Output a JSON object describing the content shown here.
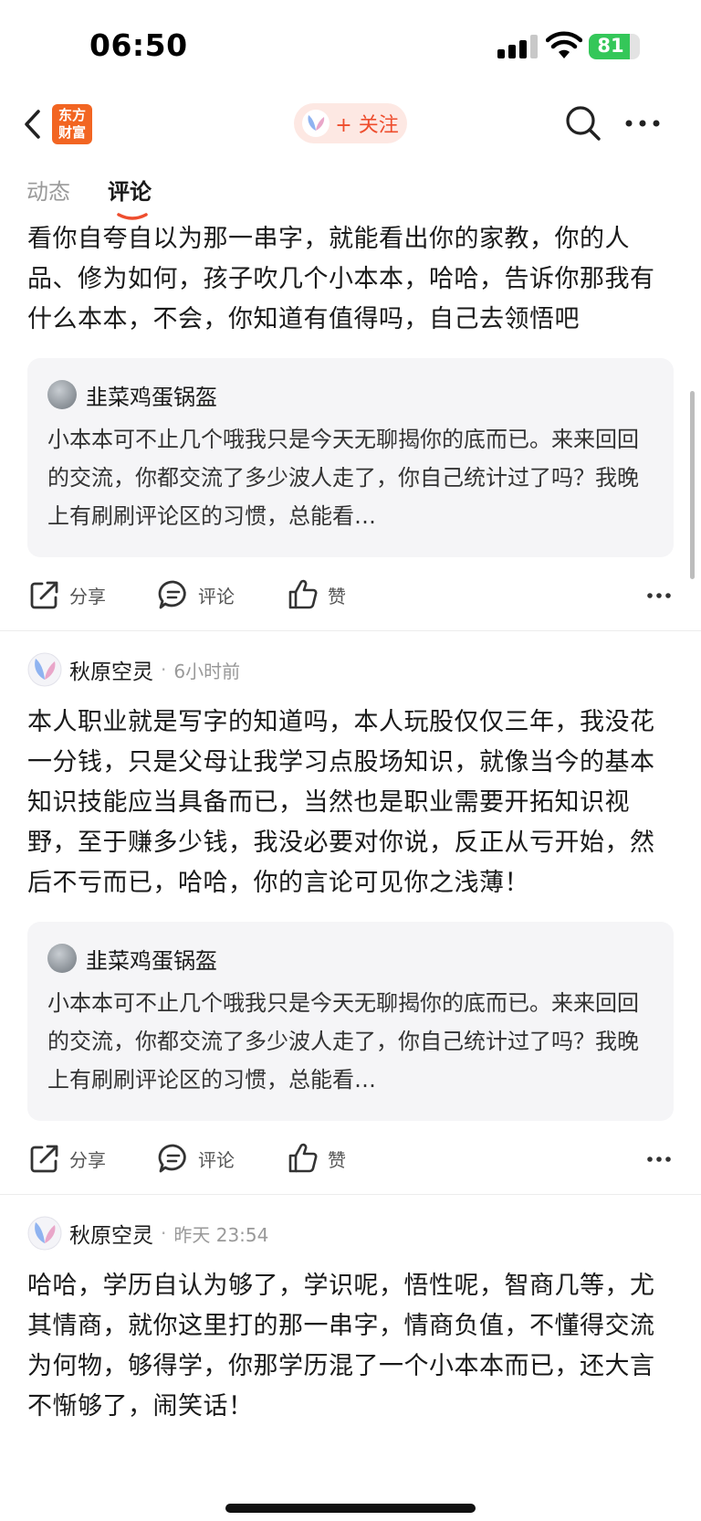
{
  "status_bar": {
    "time": "06:50",
    "battery": "81",
    "battery_level": 0.81
  },
  "nav": {
    "logo_line1": "东方",
    "logo_line2": "财富",
    "follow_label": "+ 关注"
  },
  "tabs": [
    {
      "label": "动态"
    },
    {
      "label": "评论"
    }
  ],
  "colors": {
    "accent": "#ee4d2d",
    "logo": "#f26522",
    "battery": "#34c759",
    "quote_bg": "#f5f5f7"
  },
  "posts": [
    {
      "text": "看你自夸自以为那一串字，就能看出你的家教，你的人品、修为如何，孩子吹几个小本本，哈哈，告诉你那我有什么本本，不会，你知道有值得吗，自己去领悟吧",
      "quote": {
        "user": "韭菜鸡蛋锅盔",
        "text": "小本本可不止几个哦我只是今天无聊揭你的底而已。来来回回的交流，你都交流了多少波人走了，你自己统计过了吗？我晚上有刷刷评论区的习惯，总能看…"
      },
      "actions": {
        "share": "分享",
        "comment": "评论",
        "like": "赞"
      }
    },
    {
      "user": "秋原空灵",
      "sep": "·",
      "time": "6小时前",
      "text": "本人职业就是写字的知道吗，本人玩股仅仅三年，我没花一分钱，只是父母让我学习点股场知识，就像当今的基本知识技能应当具备而已，当然也是职业需要开拓知识视野，至于赚多少钱，我没必要对你说，反正从亏开始，然后不亏而已，哈哈，你的言论可见你之浅薄！",
      "quote": {
        "user": "韭菜鸡蛋锅盔",
        "text": "小本本可不止几个哦我只是今天无聊揭你的底而已。来来回回的交流，你都交流了多少波人走了，你自己统计过了吗？我晚上有刷刷评论区的习惯，总能看…"
      },
      "actions": {
        "share": "分享",
        "comment": "评论",
        "like": "赞"
      }
    },
    {
      "user": "秋原空灵",
      "sep": "·",
      "time": "昨天 23:54",
      "text": "哈哈，学历自认为够了，学识呢，悟性呢，智商几等，尤其情商，就你这里打的那一串字，情商负值，不懂得交流为何物，够得学，你那学历混了一个小本本而已，还大言不惭够了，闹笑话！"
    }
  ]
}
